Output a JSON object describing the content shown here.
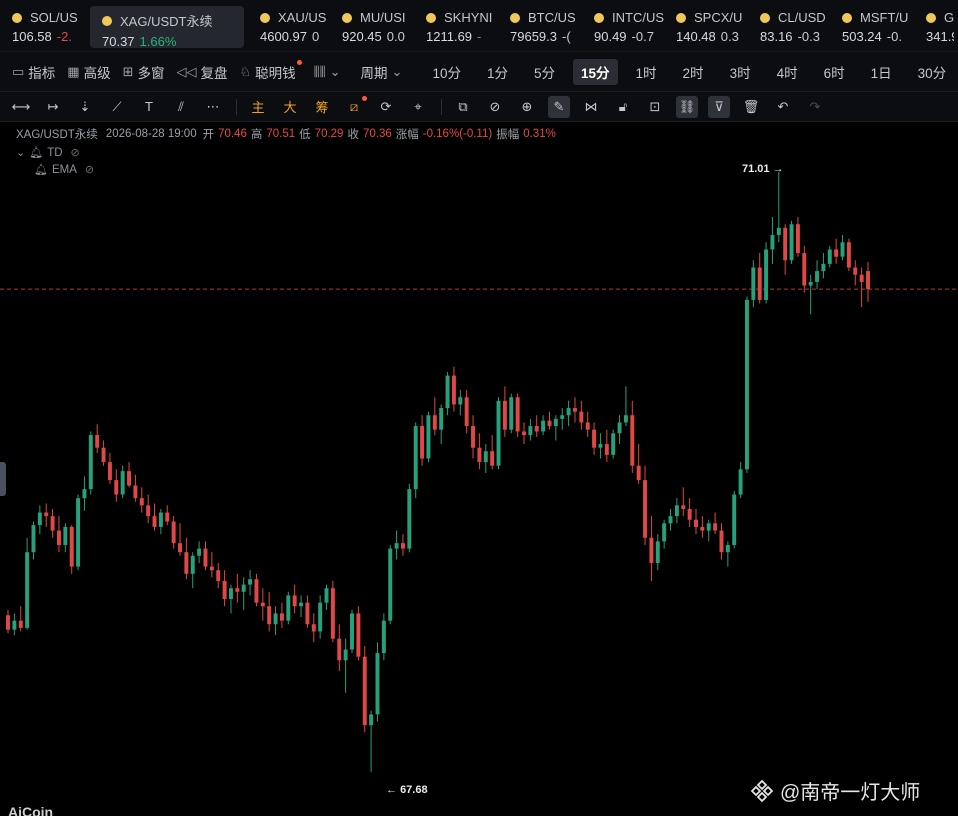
{
  "ticker": [
    {
      "symbol": "SOL/US",
      "price": "106.58",
      "change": "-2.",
      "dir": "down"
    },
    {
      "symbol": "XAG/USDT永续",
      "price": "70.37",
      "change": "1.66%",
      "dir": "up",
      "active": true
    },
    {
      "symbol": "XAU/US",
      "price": "4600.97",
      "change": "0",
      "dir": "neutral"
    },
    {
      "symbol": "MU/USI",
      "price": "920.45",
      "change": "0.0",
      "dir": "neutral"
    },
    {
      "symbol": "SKHYNI",
      "price": "1211.69",
      "change": "-",
      "dir": "up"
    },
    {
      "symbol": "BTC/US",
      "price": "79659.3",
      "change": "-(",
      "dir": "neutral"
    },
    {
      "symbol": "INTC/US",
      "price": "90.49",
      "change": "-0.7",
      "dir": "neutral"
    },
    {
      "symbol": "SPCX/U",
      "price": "140.48",
      "change": "0.3",
      "dir": "neutral"
    },
    {
      "symbol": "CL/USD",
      "price": "83.16",
      "change": "-0.3",
      "dir": "neutral"
    },
    {
      "symbol": "MSFT/U",
      "price": "503.24",
      "change": "-0.",
      "dir": "neutral"
    },
    {
      "symbol": "G",
      "price": "341.9",
      "change": "",
      "dir": "neutral"
    }
  ],
  "toolbar": {
    "indicators": "指标",
    "advanced": "高级",
    "multi_window": "多窗",
    "replay": "复盘",
    "smart_money": "聪明钱",
    "period": "周期",
    "timeframes": [
      "10分",
      "1分",
      "5分",
      "15分",
      "1时",
      "2时",
      "3时",
      "4时",
      "6时",
      "1日",
      "30分"
    ],
    "selected_timeframe": "15分"
  },
  "draw_tools": {
    "main": "主",
    "big": "大",
    "chip": "筹"
  },
  "legend": {
    "symbol": "XAG/USDT永续",
    "datetime": "2026-08-28 19:00",
    "open_label": "开",
    "open": "70.46",
    "high_label": "高",
    "high": "70.51",
    "low_label": "低",
    "low": "70.29",
    "close_label": "收",
    "close": "70.36",
    "change_label": "涨幅",
    "change": "-0.16%(-0.11)",
    "amplitude_label": "振幅",
    "amplitude": "0.31%",
    "indicators": [
      "TD",
      "EMA"
    ]
  },
  "chart_data": {
    "type": "candlestick",
    "interval": "15分",
    "high_marker": "71.01",
    "low_marker": "67.68",
    "current_price": 70.36,
    "colors": {
      "up": "#26a17b",
      "down": "#e04848",
      "price_line": "#e04848"
    },
    "candles": [
      [
        68.55,
        68.58,
        68.45,
        68.47
      ],
      [
        68.47,
        68.56,
        68.44,
        68.52
      ],
      [
        68.52,
        68.6,
        68.46,
        68.48
      ],
      [
        68.48,
        68.98,
        68.47,
        68.9
      ],
      [
        68.9,
        69.07,
        68.86,
        69.05
      ],
      [
        69.05,
        69.16,
        69.0,
        69.12
      ],
      [
        69.12,
        69.17,
        69.04,
        69.1
      ],
      [
        69.1,
        69.14,
        68.98,
        69.02
      ],
      [
        69.02,
        69.1,
        68.9,
        68.94
      ],
      [
        68.94,
        69.06,
        68.9,
        69.04
      ],
      [
        69.04,
        69.05,
        68.78,
        68.82
      ],
      [
        68.82,
        69.22,
        68.8,
        69.2
      ],
      [
        69.2,
        69.32,
        69.13,
        69.25
      ],
      [
        69.25,
        69.57,
        69.22,
        69.55
      ],
      [
        69.55,
        69.61,
        69.45,
        69.48
      ],
      [
        69.48,
        69.52,
        69.38,
        69.4
      ],
      [
        69.4,
        69.45,
        69.28,
        69.3
      ],
      [
        69.3,
        69.36,
        69.18,
        69.22
      ],
      [
        69.22,
        69.38,
        69.2,
        69.35
      ],
      [
        69.35,
        69.4,
        69.26,
        69.27
      ],
      [
        69.27,
        69.33,
        69.18,
        69.2
      ],
      [
        69.2,
        69.26,
        69.12,
        69.16
      ],
      [
        69.16,
        69.22,
        69.06,
        69.1
      ],
      [
        69.1,
        69.17,
        69.02,
        69.04
      ],
      [
        69.04,
        69.14,
        69.0,
        69.12
      ],
      [
        69.12,
        69.16,
        69.05,
        69.07
      ],
      [
        69.07,
        69.1,
        68.92,
        68.95
      ],
      [
        68.95,
        69.06,
        68.88,
        68.9
      ],
      [
        68.9,
        68.98,
        68.75,
        68.78
      ],
      [
        68.78,
        68.9,
        68.7,
        68.88
      ],
      [
        68.88,
        68.96,
        68.84,
        68.92
      ],
      [
        68.92,
        68.96,
        68.8,
        68.82
      ],
      [
        68.82,
        68.9,
        68.76,
        68.8
      ],
      [
        68.8,
        68.84,
        68.7,
        68.74
      ],
      [
        68.74,
        68.8,
        68.6,
        68.64
      ],
      [
        68.64,
        68.72,
        68.56,
        68.7
      ],
      [
        68.7,
        68.78,
        68.62,
        68.68
      ],
      [
        68.68,
        68.76,
        68.58,
        68.72
      ],
      [
        68.72,
        68.8,
        68.66,
        68.75
      ],
      [
        68.75,
        68.78,
        68.6,
        68.62
      ],
      [
        68.62,
        68.7,
        68.52,
        68.6
      ],
      [
        68.6,
        68.68,
        68.46,
        68.5
      ],
      [
        68.5,
        68.6,
        68.44,
        68.56
      ],
      [
        68.56,
        68.62,
        68.48,
        68.52
      ],
      [
        68.52,
        68.68,
        68.5,
        68.66
      ],
      [
        68.66,
        68.72,
        68.56,
        68.6
      ],
      [
        68.6,
        68.66,
        68.54,
        68.62
      ],
      [
        68.62,
        68.66,
        68.48,
        68.5
      ],
      [
        68.5,
        68.56,
        68.4,
        68.46
      ],
      [
        68.46,
        68.66,
        68.42,
        68.62
      ],
      [
        68.62,
        68.72,
        68.58,
        68.7
      ],
      [
        68.7,
        68.74,
        68.4,
        68.42
      ],
      [
        68.42,
        68.5,
        68.24,
        68.3
      ],
      [
        68.3,
        68.42,
        68.12,
        68.36
      ],
      [
        68.36,
        68.58,
        68.34,
        68.56
      ],
      [
        68.56,
        68.6,
        68.3,
        68.32
      ],
      [
        68.32,
        68.38,
        67.9,
        67.94
      ],
      [
        67.94,
        68.02,
        67.68,
        68.0
      ],
      [
        68.0,
        68.4,
        67.96,
        68.34
      ],
      [
        68.34,
        68.56,
        68.3,
        68.52
      ],
      [
        68.52,
        68.94,
        68.5,
        68.92
      ],
      [
        68.92,
        69.02,
        68.86,
        68.95
      ],
      [
        68.95,
        69.0,
        68.88,
        68.92
      ],
      [
        68.92,
        69.28,
        68.9,
        69.25
      ],
      [
        69.25,
        69.62,
        69.2,
        69.6
      ],
      [
        69.6,
        69.66,
        69.38,
        69.42
      ],
      [
        69.42,
        69.68,
        69.4,
        69.66
      ],
      [
        69.66,
        69.76,
        69.55,
        69.58
      ],
      [
        69.58,
        69.72,
        69.5,
        69.7
      ],
      [
        69.7,
        69.9,
        69.66,
        69.88
      ],
      [
        69.88,
        69.93,
        69.68,
        69.72
      ],
      [
        69.72,
        69.8,
        69.66,
        69.76
      ],
      [
        69.76,
        69.8,
        69.56,
        69.6
      ],
      [
        69.6,
        69.66,
        69.42,
        69.48
      ],
      [
        69.48,
        69.56,
        69.36,
        69.4
      ],
      [
        69.4,
        69.5,
        69.34,
        69.46
      ],
      [
        69.46,
        69.55,
        69.36,
        69.38
      ],
      [
        69.38,
        69.76,
        69.36,
        69.74
      ],
      [
        69.74,
        69.82,
        69.54,
        69.58
      ],
      [
        69.58,
        69.78,
        69.56,
        69.76
      ],
      [
        69.76,
        69.78,
        69.54,
        69.57
      ],
      [
        69.57,
        69.62,
        69.5,
        69.55
      ],
      [
        69.55,
        69.64,
        69.52,
        69.6
      ],
      [
        69.6,
        69.66,
        69.54,
        69.57
      ],
      [
        69.57,
        69.66,
        69.55,
        69.63
      ],
      [
        69.63,
        69.68,
        69.58,
        69.6
      ],
      [
        69.6,
        69.66,
        69.52,
        69.64
      ],
      [
        69.64,
        69.7,
        69.58,
        69.66
      ],
      [
        69.66,
        69.74,
        69.6,
        69.7
      ],
      [
        69.7,
        69.76,
        69.62,
        69.68
      ],
      [
        69.68,
        69.74,
        69.58,
        69.62
      ],
      [
        69.62,
        69.68,
        69.54,
        69.58
      ],
      [
        69.58,
        69.62,
        69.44,
        69.48
      ],
      [
        69.48,
        69.56,
        69.42,
        69.5
      ],
      [
        69.5,
        69.58,
        69.4,
        69.44
      ],
      [
        69.44,
        69.58,
        69.42,
        69.56
      ],
      [
        69.56,
        69.66,
        69.5,
        69.62
      ],
      [
        69.62,
        69.82,
        69.6,
        69.66
      ],
      [
        69.66,
        69.74,
        69.34,
        69.38
      ],
      [
        69.38,
        69.5,
        69.28,
        69.3
      ],
      [
        69.3,
        69.38,
        68.94,
        68.98
      ],
      [
        68.98,
        69.1,
        68.74,
        68.84
      ],
      [
        68.84,
        69.0,
        68.8,
        68.96
      ],
      [
        68.96,
        69.08,
        68.92,
        69.06
      ],
      [
        69.06,
        69.14,
        69.02,
        69.1
      ],
      [
        69.1,
        69.2,
        69.06,
        69.16
      ],
      [
        69.16,
        69.26,
        69.1,
        69.14
      ],
      [
        69.14,
        69.2,
        69.04,
        69.08
      ],
      [
        69.08,
        69.14,
        69.0,
        69.04
      ],
      [
        69.04,
        69.1,
        68.98,
        69.02
      ],
      [
        69.02,
        69.08,
        68.96,
        69.06
      ],
      [
        69.06,
        69.12,
        69.0,
        69.02
      ],
      [
        69.02,
        69.06,
        68.86,
        68.9
      ],
      [
        68.9,
        68.96,
        68.82,
        68.94
      ],
      [
        68.94,
        69.24,
        68.92,
        69.22
      ],
      [
        69.22,
        69.4,
        69.2,
        69.36
      ],
      [
        69.36,
        70.32,
        69.34,
        70.3
      ],
      [
        70.3,
        70.52,
        70.26,
        70.48
      ],
      [
        70.48,
        70.56,
        70.28,
        70.3
      ],
      [
        70.3,
        70.62,
        70.28,
        70.58
      ],
      [
        70.58,
        70.76,
        70.5,
        70.66
      ],
      [
        70.66,
        71.01,
        70.62,
        70.7
      ],
      [
        70.7,
        70.72,
        70.44,
        70.52
      ],
      [
        70.52,
        70.74,
        70.5,
        70.72
      ],
      [
        70.72,
        70.76,
        70.54,
        70.56
      ],
      [
        70.56,
        70.6,
        70.34,
        70.38
      ],
      [
        70.38,
        70.44,
        70.22,
        70.4
      ],
      [
        70.4,
        70.52,
        70.36,
        70.46
      ],
      [
        70.46,
        70.56,
        70.42,
        70.5
      ],
      [
        70.5,
        70.6,
        70.48,
        70.58
      ],
      [
        70.58,
        70.64,
        70.5,
        70.54
      ],
      [
        70.54,
        70.66,
        70.52,
        70.62
      ],
      [
        70.62,
        70.64,
        70.46,
        70.48
      ],
      [
        70.48,
        70.52,
        70.38,
        70.44
      ],
      [
        70.44,
        70.48,
        70.26,
        70.4
      ],
      [
        70.46,
        70.51,
        70.29,
        70.36
      ]
    ]
  },
  "watermark": "@南帝一灯大师",
  "brand": "AiCoin"
}
